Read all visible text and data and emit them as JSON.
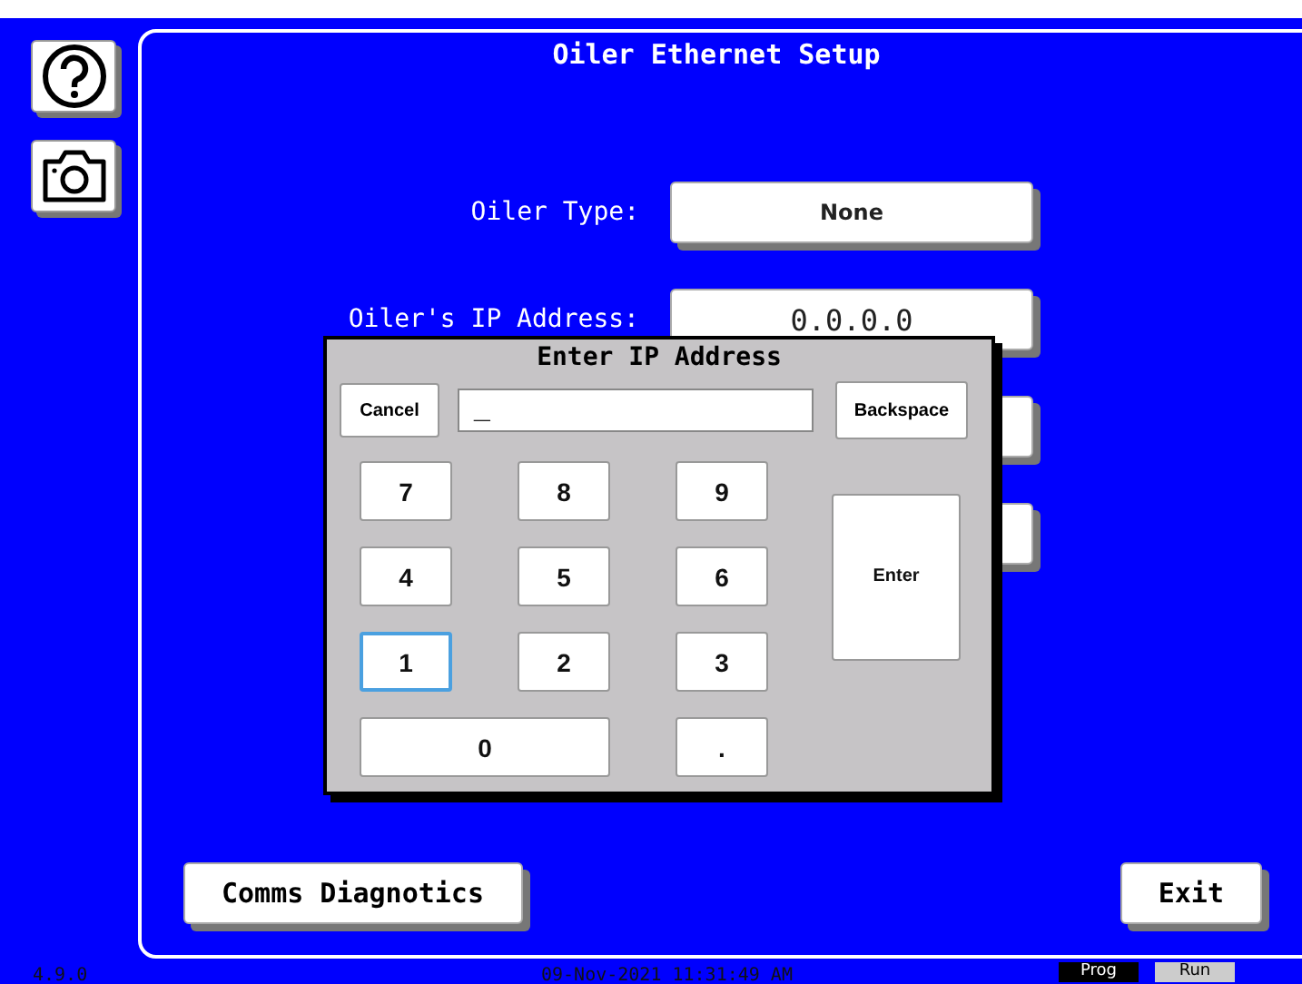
{
  "window": {
    "title": "Oiler Ethernet Setup"
  },
  "fields": [
    {
      "label": "Oiler Type:",
      "value": "None",
      "kind": "text"
    },
    {
      "label": "Oiler's IP Address:",
      "value": "0.0.0.0",
      "kind": "mono"
    }
  ],
  "footer_buttons": [
    {
      "label": "Comms Diagnotics"
    },
    {
      "label": "Exit"
    }
  ],
  "dialog": {
    "title": "Enter IP Address",
    "cancel": "Cancel",
    "input_value": "_",
    "backspace": "Backspace",
    "keys": [
      {
        "label": "7",
        "kind": "digit",
        "focused": false
      },
      {
        "label": "8",
        "kind": "digit",
        "focused": false
      },
      {
        "label": "9",
        "kind": "digit",
        "focused": false
      },
      {
        "label": "4",
        "kind": "digit",
        "focused": false
      },
      {
        "label": "5",
        "kind": "digit",
        "focused": false
      },
      {
        "label": "6",
        "kind": "digit",
        "focused": false
      },
      {
        "label": "1",
        "kind": "digit",
        "focused": true
      },
      {
        "label": "2",
        "kind": "digit",
        "focused": false
      },
      {
        "label": "3",
        "kind": "digit",
        "focused": false
      },
      {
        "label": "0",
        "kind": "wide",
        "focused": false
      },
      {
        "label": ".",
        "kind": "digit",
        "focused": false
      },
      {
        "label": "Enter",
        "kind": "enter",
        "focused": false
      }
    ]
  },
  "status_bar": {
    "version": "4.9.0",
    "datetime": "09-Nov-2021 11:31:49 AM",
    "modes": [
      {
        "label": "Prog",
        "selected": true
      },
      {
        "label": "Run",
        "selected": false
      }
    ]
  }
}
